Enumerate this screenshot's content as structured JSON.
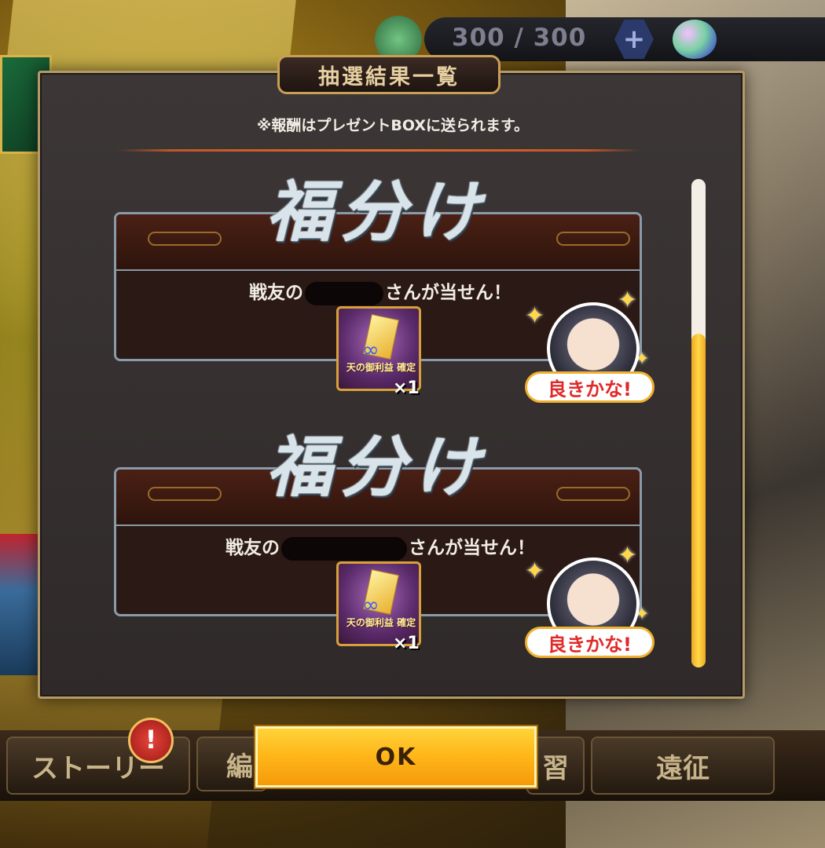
{
  "status_bar": {
    "stamina": "300 / 300",
    "add_button": "+"
  },
  "bottom_nav": {
    "story": "ストーリー",
    "edit": "編",
    "train": "習",
    "expedition": "遠征",
    "alert": "!"
  },
  "modal": {
    "title": "抽選結果一覧",
    "notice": "※報酬はプレゼントBOXに送られます。",
    "cards": [
      {
        "heading": "福分け",
        "winner_prefix": "戦友の",
        "winner_suffix": "さんが当せん！",
        "item_label": "天の御利益 確定",
        "quantity": "×1",
        "stamp_text": "良きかな!"
      },
      {
        "heading": "福分け",
        "winner_prefix": "戦友の",
        "winner_suffix": "さんが当せん！",
        "item_label": "天の御利益 確定",
        "quantity": "×1",
        "stamp_text": "良きかな!"
      }
    ],
    "ok_label": "OK"
  }
}
